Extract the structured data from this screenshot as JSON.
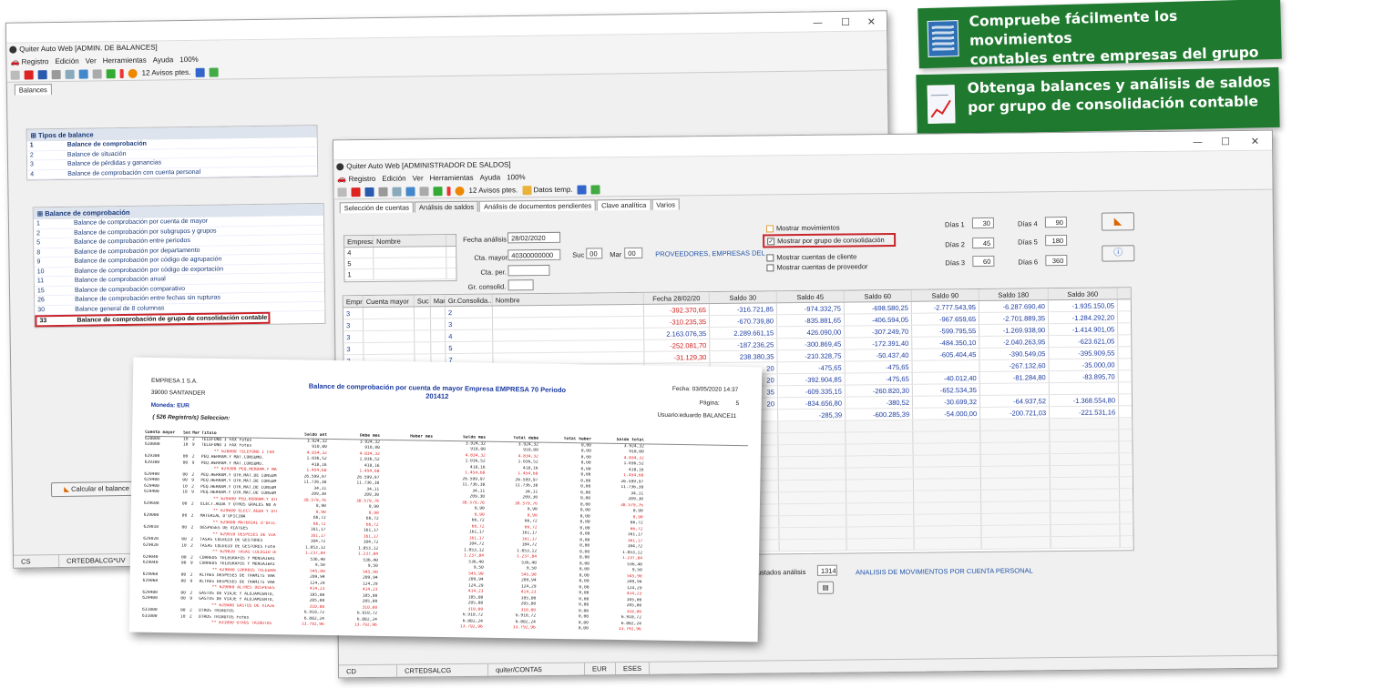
{
  "banners": [
    {
      "line1": "Compruebe fácilmente los movimientos",
      "line2": "contables entre empresas del grupo",
      "icon": "building-icon"
    },
    {
      "line1": "Obtenga balances y análisis de saldos",
      "line2": "por grupo de consolidación contable",
      "icon": "chart-document-icon"
    }
  ],
  "win1": {
    "title": "Quiter Auto Web  [ADMIN. DE BALANCES]",
    "menu": [
      "Registro",
      "Edición",
      "Ver",
      "Herramientas",
      "Ayuda",
      "100%"
    ],
    "avisos": "12 Avisos ptes.",
    "tab": "Balances",
    "types_header": "Tipos de balance",
    "types": [
      {
        "n": "1",
        "t": "Balance de comprobación"
      },
      {
        "n": "2",
        "t": "Balance de situación"
      },
      {
        "n": "3",
        "t": "Balance de pérdidas y ganancias"
      },
      {
        "n": "4",
        "t": "Balance de comprobación con cuenta personal"
      }
    ],
    "sub_header": "Balance de comprobación",
    "subs": [
      {
        "n": "1",
        "t": "Balance de comprobación por cuenta de mayor"
      },
      {
        "n": "2",
        "t": "Balance de comprobación por subgrupos y grupos"
      },
      {
        "n": "5",
        "t": "Balance de comprobación entre periodos"
      },
      {
        "n": "8",
        "t": "Balance de comprobación por departamento"
      },
      {
        "n": "9",
        "t": "Balance de comprobación por código de agrupación"
      },
      {
        "n": "10",
        "t": "Balance de comprobación por código de exportación"
      },
      {
        "n": "11",
        "t": "Balance de comprobación anual"
      },
      {
        "n": "15",
        "t": "Balance de comprobación comparativo"
      },
      {
        "n": "26",
        "t": "Balance de comprobación entre fechas sin rupturas"
      },
      {
        "n": "30",
        "t": "Balance general de 8 columnas"
      },
      {
        "n": "33",
        "t": "Balance de comprobación de grupo de consolidación contable"
      }
    ],
    "calc_button": "Calcular el balance",
    "status": [
      "CS",
      "CRTEDBALCG*UV"
    ]
  },
  "win2": {
    "title": "Quiter Auto Web  [ADMINISTRADOR DE SALDOS]",
    "menu": [
      "Registro",
      "Edición",
      "Ver",
      "Herramientas",
      "Ayuda",
      "100%"
    ],
    "avisos": "12 Avisos ptes.",
    "datos": "Datos temp.",
    "tabs": [
      "Selección de cuentas",
      "Análisis de saldos",
      "Análisis de documentos pendientes",
      "Clave analítica",
      "Varios"
    ],
    "emp_header": [
      "Empresa",
      "Nombre"
    ],
    "emp_rows": [
      "4",
      "5",
      "1"
    ],
    "fecha_label": "Fecha análisis",
    "fecha": "28/02/2020",
    "cta_label": "Cta. mayor",
    "cta": "40300000000",
    "suc_label": "Suc",
    "suc": "00",
    "mar_label": "Mar",
    "mar": "00",
    "proveedores": "PROVEEDORES, EMPRESAS DEL ...",
    "ctaper_label": "Cta. per.",
    "grcons_label": "Gr. consolid.",
    "checks": [
      {
        "label": "Mostrar movimientos",
        "checked": false
      },
      {
        "label": "Mostrar  por grupo de consolidación",
        "checked": true
      },
      {
        "label": "Mostrar cuentas de cliente",
        "checked": false
      },
      {
        "label": "Mostrar cuentas de proveedor",
        "checked": false
      }
    ],
    "dias": [
      {
        "label": "Días 1",
        "value": "30"
      },
      {
        "label": "Días 2",
        "value": "45"
      },
      {
        "label": "Días 3",
        "value": "60"
      },
      {
        "label": "Días 4",
        "value": "90"
      },
      {
        "label": "Días 5",
        "value": "180"
      },
      {
        "label": "Días 6",
        "value": "360"
      }
    ],
    "grid_header": [
      "Empr",
      "Cuenta mayor",
      "Suc",
      "Mar",
      "Gr.Consolida...",
      "Nombre",
      "Fecha 28/02/20",
      "Saldo 30",
      "Saldo 45",
      "Saldo 60",
      "Saldo 90",
      "Saldo 180",
      "Saldo 360"
    ],
    "grid_rows": [
      [
        "3",
        "",
        "",
        "",
        "2",
        "",
        "-392.370,65",
        "-316.721,85",
        "-974.332,75",
        "-698.580,25",
        "-2.777.543,95",
        "-6.287.690,40",
        "-1.935.150,05"
      ],
      [
        "3",
        "",
        "",
        "",
        "3",
        "",
        "-310.235,35",
        "-670.739,80",
        "-835.881,65",
        "-406.594,05",
        "-967.659,65",
        "-2.701.889,35",
        "-1.284.292,20"
      ],
      [
        "3",
        "",
        "",
        "",
        "4",
        "",
        "2.163.076,35",
        "2.289.661,15",
        "426.090,00",
        "-307.249,70",
        "-599.795,55",
        "-1.269.938,90",
        "-1.414.901,05"
      ],
      [
        "3",
        "",
        "",
        "",
        "5",
        "",
        "-252.081,70",
        "-187.236,25",
        "-300.869,45",
        "-172.391,40",
        "-484.350,10",
        "-2.040.263,95",
        "-623.621,05"
      ],
      [
        "3",
        "",
        "",
        "",
        "7",
        "",
        "-31.129,30",
        "238.380,35",
        "-210.328,75",
        "-50.437,40",
        "-605.404,45",
        "-390.549,05",
        "-395.909,55"
      ],
      [
        "",
        "",
        "",
        "",
        "",
        "",
        "",
        "20",
        "-475,65",
        "-475,65",
        "",
        "-267.132,60",
        "-35.000,00"
      ],
      [
        "",
        "",
        "",
        "",
        "",
        "",
        "",
        "20",
        "-392.904,85",
        "-475,65",
        "-40.012,40",
        "-81.284,80",
        "-83.895,70"
      ],
      [
        "",
        "",
        "",
        "",
        "",
        "",
        "",
        "35",
        "-609.335,15",
        "-260.820,30",
        "-652.534,35",
        "",
        ""
      ],
      [
        "",
        "",
        "",
        "",
        "",
        "",
        "",
        "20",
        "-834.656,80",
        "-380,52",
        "-30.699,32",
        "-64.937,52",
        "-1.368.554,80"
      ],
      [
        "",
        "",
        "",
        "",
        "",
        "",
        "",
        "",
        "-285,39",
        "-600.285,39",
        "-54.000,00",
        "-200.721,03",
        "-221.531,16"
      ]
    ],
    "resultados_label": "ustados análisis",
    "resultados": "1314",
    "analisis_link": "ANALISIS DE MOVIMIENTOS POR CUENTA PERSONAL",
    "status": [
      "CD",
      "CRTEDSALCG",
      "quiter/CONTA5",
      "EUR",
      "ESES"
    ]
  },
  "report": {
    "company": "EMPRESA 1 S.A.",
    "city": "39000 SANTANDER",
    "title": "Balance de comprobación por cuenta de mayor Empresa EMPRESA 70 Periodo",
    "period": "201412",
    "fecha": "Fecha: 03/05/2020 14:37",
    "pagina_label": "Página:",
    "pagina": "5",
    "moneda": "Moneda: EUR",
    "usuario": "Usuario:eduardo   BALANCE11",
    "registros": "( 526 Registro/s) Seleccion:",
    "cols": [
      "Cuenta mayor",
      "Suc",
      "Mar",
      "Titulo",
      "Saldo ant",
      "Debe mes",
      "Haber mes",
      "Saldo mes",
      "Total debe",
      "Total haber",
      "Saldo total"
    ],
    "lines": [
      [
        "628000",
        "10",
        "2",
        "TELEFONO I FAX Fotes",
        "3.924,32",
        "3.924,32",
        "",
        "3.924,32",
        "3.924,32",
        "0,00",
        "3.924,32",
        0
      ],
      [
        "628000",
        "10",
        "9",
        "TELEFONO I FAX Fotes",
        "910,00",
        "910,00",
        "",
        "910,00",
        "910,00",
        "0,00",
        "910,00",
        0
      ],
      [
        "",
        "",
        "",
        "** 628000 TELEFONO I FAX",
        "4.834,32",
        "4.834,32",
        "",
        "4.834,32",
        "4.834,32",
        "0,00",
        "4.834,32",
        1
      ],
      [
        "629300",
        "00",
        "2",
        "PEQ.HERRAM.Y MAT.CONSUMO.",
        "1.036,52",
        "1.036,52",
        "",
        "1.036,52",
        "1.036,52",
        "0,00",
        "1.036,52",
        0
      ],
      [
        "629300",
        "00",
        "9",
        "PEQ.HERRAM.Y MAT.CONSUMO.",
        "418,16",
        "418,16",
        "",
        "418,16",
        "418,16",
        "0,00",
        "418,16",
        0
      ],
      [
        "",
        "",
        "",
        "** 629300 PEQ.HERRAM.Y MAT.CON",
        "1.454,68",
        "1.454,68",
        "",
        "1.454,68",
        "1.454,68",
        "0,00",
        "1.454,68",
        1
      ],
      [
        "629400",
        "00",
        "2",
        "PEQ.HERRAM.Y OTR.MAT.DE CONSUM",
        "26.599,97",
        "26.599,97",
        "",
        "26.599,97",
        "26.599,97",
        "0,00",
        "26.599,97",
        0
      ],
      [
        "629400",
        "00",
        "9",
        "PEQ.HERRAM.Y OTR.MAT.DE CONSUM",
        "11.736,38",
        "11.736,38",
        "",
        "11.736,38",
        "11.736,38",
        "0,00",
        "11.736,38",
        0
      ],
      [
        "629400",
        "10",
        "2",
        "PEQ.HERRAM.Y OTR.MAT.DE CONSUM",
        "34,11",
        "34,11",
        "",
        "34,11",
        "34,11",
        "0,00",
        "34,11",
        0
      ],
      [
        "629400",
        "10",
        "9",
        "PEQ.HERRAM.Y OTR.MAT.DE CONSUM",
        "209,30",
        "209,30",
        "",
        "209,30",
        "209,30",
        "0,00",
        "209,30",
        0
      ],
      [
        "",
        "",
        "",
        "** 629400 PEQ.HERRAM.Y OTR.MAT",
        "38.579,76",
        "38.579,76",
        "",
        "38.579,76",
        "38.579,76",
        "0,00",
        "38.579,76",
        1
      ],
      [
        "629600",
        "00",
        "2",
        "ELECT.AGUA Y OTROS GRALES NO A",
        "0,90",
        "0,90",
        "",
        "0,90",
        "0,90",
        "0,00",
        "0,90",
        0
      ],
      [
        "",
        "",
        "",
        "** 629600 ELECT.AGUA Y OTROS G",
        "0,90",
        "0,90",
        "",
        "0,90",
        "0,90",
        "0,00",
        "0,90",
        1
      ],
      [
        "629000",
        "00",
        "2",
        "MATERIAL D'OFICINA",
        "66,72",
        "66,72",
        "",
        "66,72",
        "66,72",
        "0,00",
        "66,72",
        0
      ],
      [
        "",
        "",
        "",
        "** 629000 MATERIAL D'OFICINA",
        "66,72",
        "66,72",
        "",
        "66,72",
        "66,72",
        "0,00",
        "66,72",
        1
      ],
      [
        "629010",
        "00",
        "2",
        "DESPESES DE VIATGES",
        "161,17",
        "161,17",
        "",
        "161,17",
        "161,17",
        "0,00",
        "161,17",
        0
      ],
      [
        "",
        "",
        "",
        "** 629010 DESPESES DE VIATGES",
        "161,17",
        "161,17",
        "",
        "161,17",
        "161,17",
        "0,00",
        "161,17",
        1
      ],
      [
        "629020",
        "00",
        "2",
        "TASAS COLEGIO DE GESTORES",
        "104,72",
        "104,72",
        "",
        "104,72",
        "104,72",
        "0,00",
        "104,72",
        0
      ],
      [
        "629020",
        "10",
        "2",
        "TASAS COLEGIO DE GESTORES Fote",
        "1.053,12",
        "1.053,12",
        "",
        "1.053,12",
        "1.053,12",
        "0,00",
        "1.053,12",
        0
      ],
      [
        "",
        "",
        "",
        "** 629020 TASAS COLEGIO DE GES",
        "1.237,84",
        "1.237,84",
        "",
        "1.237,84",
        "1.237,84",
        "0,00",
        "1.237,84",
        1
      ],
      [
        "629040",
        "00",
        "2",
        "CORREOS TELEGRAFOS Y MENSAJERI",
        "536,40",
        "536,40",
        "",
        "536,40",
        "536,40",
        "0,00",
        "536,40",
        0
      ],
      [
        "629040",
        "00",
        "9",
        "CORREOS TELEGRAFOS Y MENSAJERI",
        "9,50",
        "9,50",
        "",
        "9,50",
        "9,50",
        "0,00",
        "9,50",
        0
      ],
      [
        "",
        "",
        "",
        "** 629040 CORREOS TELEGRAFOS Y",
        "545,90",
        "545,90",
        "",
        "545,90",
        "545,90",
        "0,00",
        "545,90",
        1
      ],
      [
        "629060",
        "00",
        "2",
        "ALTRES DESPESES DE TRAMITS VAR",
        "209,94",
        "209,94",
        "",
        "209,94",
        "209,94",
        "0,00",
        "209,94",
        0
      ],
      [
        "629060",
        "00",
        "9",
        "ALTRES DESPESES DE TRAMITS VAR",
        "124,29",
        "124,29",
        "",
        "124,29",
        "124,29",
        "0,00",
        "124,29",
        0
      ],
      [
        "",
        "",
        "",
        "** 629060 ALTRES DESPESES DE T",
        "414,23",
        "414,23",
        "",
        "414,23",
        "414,23",
        "0,00",
        "414,23",
        1
      ],
      [
        "629400",
        "00",
        "2",
        "GASTOS DE VIAJE Y ALOJAMIENTO,",
        "105,00",
        "105,00",
        "",
        "105,00",
        "105,00",
        "0,00",
        "105,00",
        0
      ],
      [
        "629400",
        "00",
        "9",
        "GASTOS DE VIAJE Y ALOJAMIENTO,",
        "205,00",
        "205,00",
        "",
        "205,00",
        "205,00",
        "0,00",
        "205,00",
        0
      ],
      [
        "",
        "",
        "",
        "** 629400 GASTOS DE VIAJE Y AL",
        "310,00",
        "310,00",
        "",
        "310,00",
        "310,00",
        "0,00",
        "310,00",
        1
      ],
      [
        "631000",
        "00",
        "2",
        "OTROS TRIBUTOS",
        "6.910,72",
        "6.910,72",
        "",
        "6.910,72",
        "6.910,72",
        "0,00",
        "6.910,72",
        0
      ],
      [
        "631000",
        "10",
        "2",
        "OTROS TRIBUTOS Fotes",
        "6.882,24",
        "6.882,24",
        "",
        "6.882,24",
        "6.882,24",
        "0,00",
        "6.882,24",
        0
      ],
      [
        "",
        "",
        "",
        "** 631000 OTROS TRIBUTOS",
        "13.792,96",
        "13.792,96",
        "",
        "13.792,96",
        "13.792,96",
        "0,00",
        "13.792,96",
        1
      ]
    ]
  }
}
